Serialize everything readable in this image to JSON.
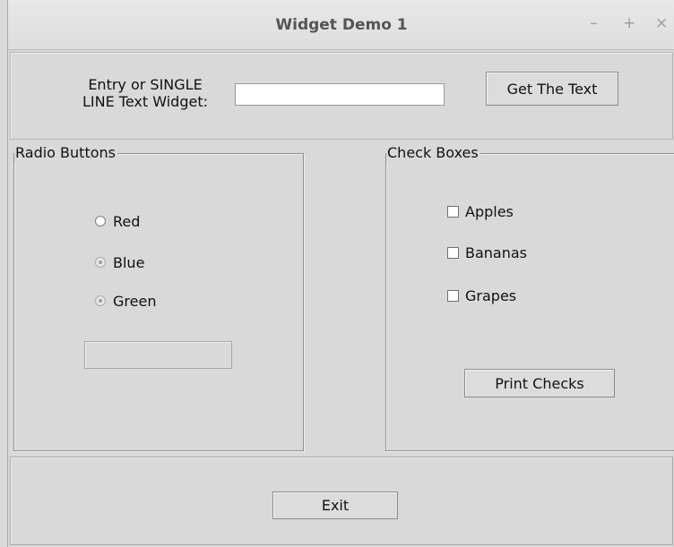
{
  "window": {
    "title": "Widget Demo 1",
    "controls": {
      "minimize": "–",
      "maximize": "+",
      "close": "×"
    }
  },
  "entry_section": {
    "label_line1": "Entry or SINGLE",
    "label_line2": "LINE Text Widget:",
    "input_value": "",
    "get_text_button": "Get The Text"
  },
  "radio_section": {
    "title": "Radio Buttons",
    "options": [
      {
        "label": "Red",
        "state": "normal"
      },
      {
        "label": "Blue",
        "state": "dimmed-selected"
      },
      {
        "label": "Green",
        "state": "dimmed-selected"
      }
    ],
    "output_value": ""
  },
  "check_section": {
    "title": "Check Boxes",
    "options": [
      {
        "label": "Apples",
        "checked": false
      },
      {
        "label": "Bananas",
        "checked": false
      },
      {
        "label": "Grapes",
        "checked": false
      }
    ],
    "print_button": "Print Checks"
  },
  "footer": {
    "exit_button": "Exit"
  }
}
